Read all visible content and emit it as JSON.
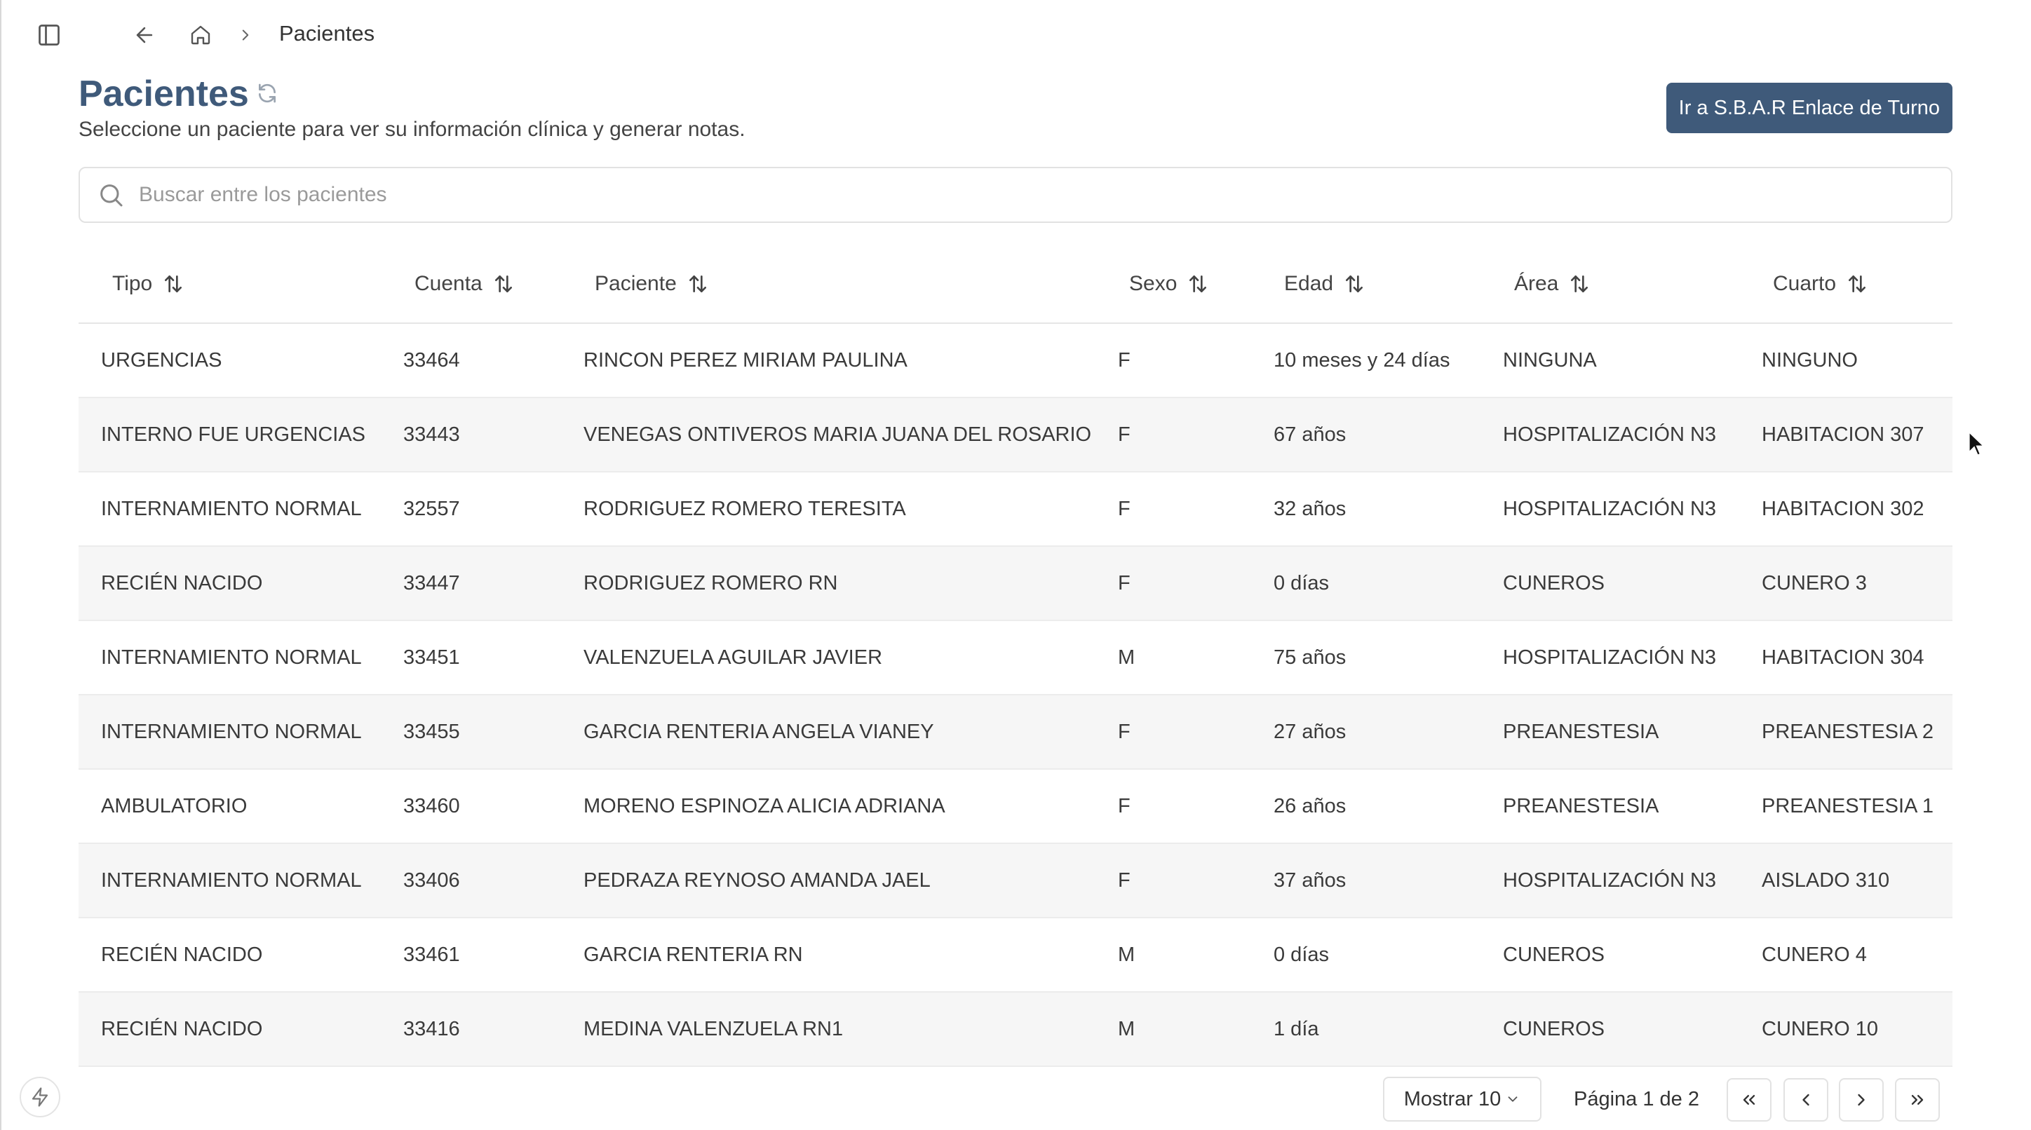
{
  "breadcrumb": {
    "current": "Pacientes"
  },
  "header": {
    "title": "Pacientes",
    "subtitle": "Seleccione un paciente para ver su información clínica y generar notas.",
    "sbar_button": "Ir a S.B.A.R Enlace de Turno"
  },
  "search": {
    "placeholder": "Buscar entre los pacientes",
    "value": ""
  },
  "table": {
    "columns": [
      "Tipo",
      "Cuenta",
      "Paciente",
      "Sexo",
      "Edad",
      "Área",
      "Cuarto"
    ],
    "rows": [
      [
        "URGENCIAS",
        "33464",
        "RINCON PEREZ MIRIAM PAULINA",
        "F",
        "10 meses y 24 días",
        "NINGUNA",
        "NINGUNO"
      ],
      [
        "INTERNO FUE URGENCIAS",
        "33443",
        "VENEGAS ONTIVEROS MARIA JUANA DEL ROSARIO",
        "F",
        "67 años",
        "HOSPITALIZACIÓN N3",
        "HABITACION 307"
      ],
      [
        "INTERNAMIENTO NORMAL",
        "32557",
        "RODRIGUEZ ROMERO TERESITA",
        "F",
        "32 años",
        "HOSPITALIZACIÓN N3",
        "HABITACION 302"
      ],
      [
        "RECIÉN NACIDO",
        "33447",
        "RODRIGUEZ ROMERO RN",
        "F",
        "0 días",
        "CUNEROS",
        "CUNERO 3"
      ],
      [
        "INTERNAMIENTO NORMAL",
        "33451",
        "VALENZUELA AGUILAR JAVIER",
        "M",
        "75 años",
        "HOSPITALIZACIÓN N3",
        "HABITACION 304"
      ],
      [
        "INTERNAMIENTO NORMAL",
        "33455",
        "GARCIA RENTERIA ANGELA VIANEY",
        "F",
        "27 años",
        "PREANESTESIA",
        "PREANESTESIA 2"
      ],
      [
        "AMBULATORIO",
        "33460",
        "MORENO ESPINOZA ALICIA ADRIANA",
        "F",
        "26 años",
        "PREANESTESIA",
        "PREANESTESIA 1"
      ],
      [
        "INTERNAMIENTO NORMAL",
        "33406",
        "PEDRAZA REYNOSO AMANDA JAEL",
        "F",
        "37 años",
        "HOSPITALIZACIÓN N3",
        "AISLADO 310"
      ],
      [
        "RECIÉN NACIDO",
        "33461",
        "GARCIA RENTERIA RN",
        "M",
        "0 días",
        "CUNEROS",
        "CUNERO 4"
      ],
      [
        "RECIÉN NACIDO",
        "33416",
        "MEDINA VALENZUELA RN1",
        "M",
        "1 día",
        "CUNEROS",
        "CUNERO 10"
      ]
    ]
  },
  "pagination": {
    "page_size": "Mostrar 10",
    "page_info": "Página 1 de 2"
  },
  "colors": {
    "accent": "#3f5a7a",
    "row_alt": "#f6f6f6"
  },
  "icons": [
    "sidebar-toggle-icon",
    "arrow-left-icon",
    "home-icon",
    "chevron-right-icon",
    "refresh-icon",
    "search-icon",
    "sort-icon",
    "chevron-down-icon",
    "chevrons-left-icon",
    "chevron-left-icon",
    "chevrons-right-icon",
    "bolt-icon",
    "cursor-icon"
  ]
}
